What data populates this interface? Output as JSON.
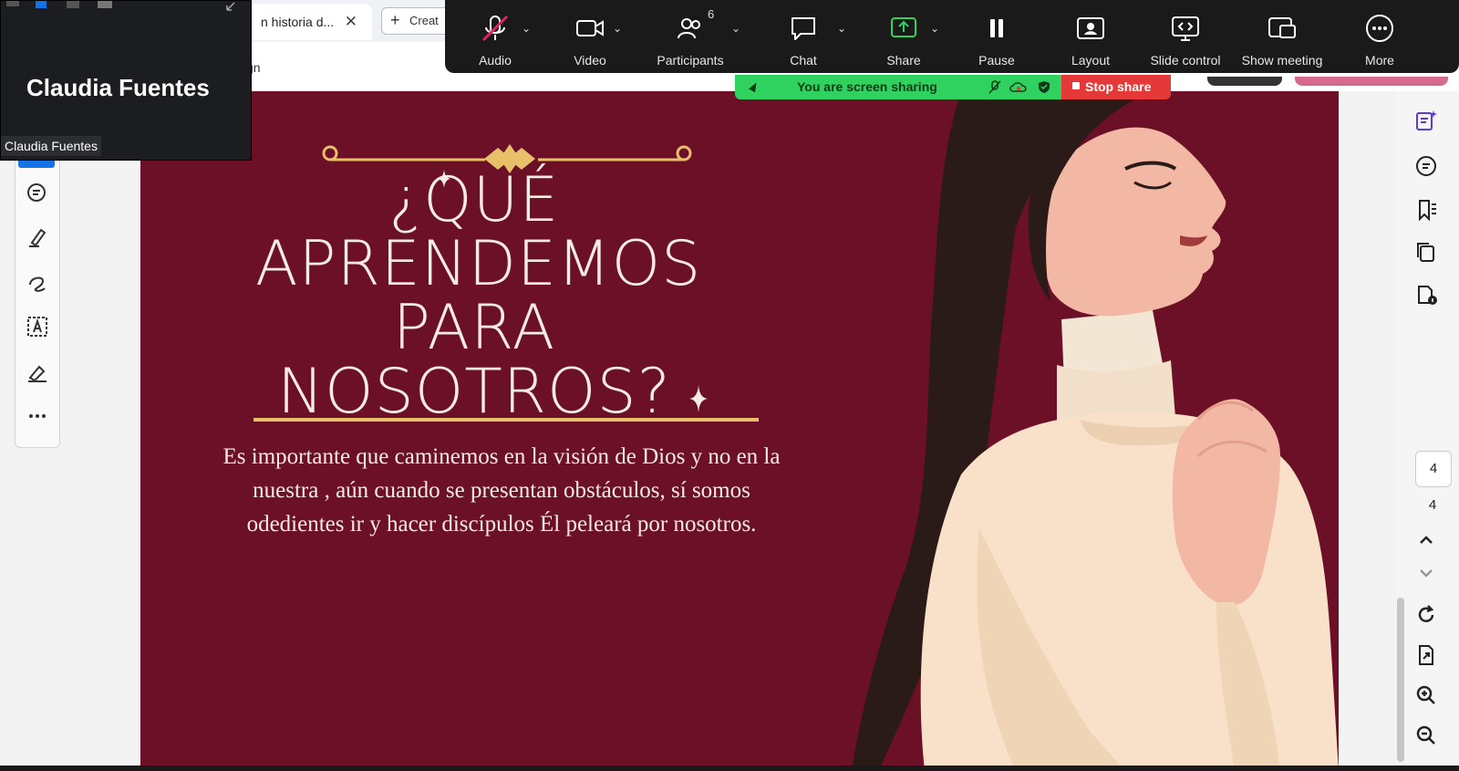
{
  "browser": {
    "tab_title": "n historia d...",
    "new_tab_label": "Creat",
    "address_fragment": "gn"
  },
  "video_thumbnail": {
    "participant_name": "Claudia Fuentes",
    "name_label": "Claudia Fuentes"
  },
  "zoom_toolbar": {
    "items": [
      {
        "label": "Audio"
      },
      {
        "label": "Video"
      },
      {
        "label": "Participants",
        "count": "6"
      },
      {
        "label": "Chat"
      },
      {
        "label": "Share"
      },
      {
        "label": "Pause"
      },
      {
        "label": "Layout"
      },
      {
        "label": "Slide control"
      },
      {
        "label": "Show meeting"
      },
      {
        "label": "More"
      }
    ],
    "colors": {
      "share_accent": "#2fd15f",
      "audio_muted": "#e0245e"
    }
  },
  "share_banner": {
    "status_text": "You are screen sharing",
    "stop_label": "Stop share",
    "colors": {
      "banner": "#2fd15f",
      "stop": "#e53838"
    }
  },
  "slide": {
    "title_lines": [
      "¿QUÉ",
      "APRENDEMOS",
      "PARA",
      "NOSOTROS?"
    ],
    "body": "Es importante que caminemos en la visión de Dios y no en la nuestra , aún cuando se presentan obstáculos, sí somos odedientes ir y hacer discípulos Él peleará por nosotros.",
    "colors": {
      "background": "#6c1028",
      "accent": "#e8c06a",
      "text": "#f7ebe3"
    }
  },
  "page_nav": {
    "current_page": "4",
    "total_pages": "4"
  }
}
